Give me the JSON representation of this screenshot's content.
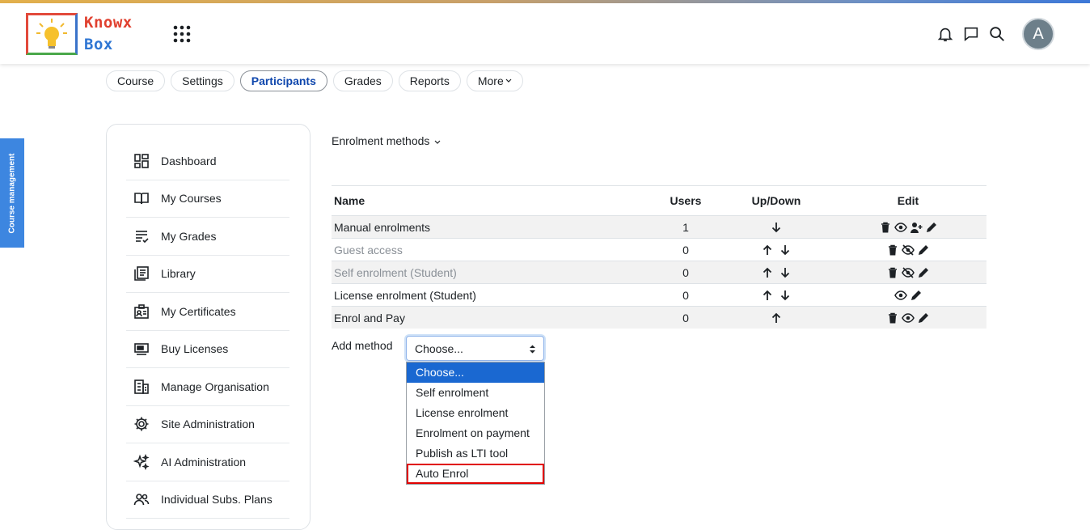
{
  "brand": {
    "line1": "Knowx",
    "line2": "Box"
  },
  "user": {
    "avatar_initial": "A"
  },
  "tabs": [
    {
      "label": "Course",
      "active": false
    },
    {
      "label": "Settings",
      "active": false
    },
    {
      "label": "Participants",
      "active": true
    },
    {
      "label": "Grades",
      "active": false
    },
    {
      "label": "Reports",
      "active": false
    },
    {
      "label": "More",
      "active": false
    }
  ],
  "course_management_label": "Course management",
  "sidebar": {
    "items": [
      {
        "label": "Dashboard",
        "icon": "dashboard-icon"
      },
      {
        "label": "My Courses",
        "icon": "book-open-icon"
      },
      {
        "label": "My Grades",
        "icon": "grades-list-icon"
      },
      {
        "label": "Library",
        "icon": "library-icon"
      },
      {
        "label": "My Certificates",
        "icon": "certificate-icon"
      },
      {
        "label": "Buy Licenses",
        "icon": "license-icon"
      },
      {
        "label": "Manage Organisation",
        "icon": "building-icon"
      },
      {
        "label": "Site Administration",
        "icon": "gear-icon"
      },
      {
        "label": "AI Administration",
        "icon": "sparkles-icon"
      },
      {
        "label": "Individual Subs. Plans",
        "icon": "users-icon"
      }
    ]
  },
  "enrolment": {
    "heading": "Enrolment methods",
    "columns": {
      "name": "Name",
      "users": "Users",
      "updown": "Up/Down",
      "edit": "Edit"
    },
    "rows": [
      {
        "name": "Manual enrolments",
        "users": "1",
        "enabled": true
      },
      {
        "name": "Guest access",
        "users": "0",
        "enabled": false
      },
      {
        "name": "Self enrolment (Student)",
        "users": "0",
        "enabled": false
      },
      {
        "name": "License enrolment (Student)",
        "users": "0",
        "enabled": true
      },
      {
        "name": "Enrol and Pay",
        "users": "0",
        "enabled": true
      }
    ]
  },
  "add_method": {
    "label": "Add method",
    "selected": "Choose...",
    "options": [
      "Choose...",
      "Self enrolment",
      "License enrolment",
      "Enrolment on payment",
      "Publish as LTI tool",
      "Auto Enrol"
    ]
  },
  "colors": {
    "accent": "#1a68d1",
    "highlight_border": "#e00000"
  }
}
